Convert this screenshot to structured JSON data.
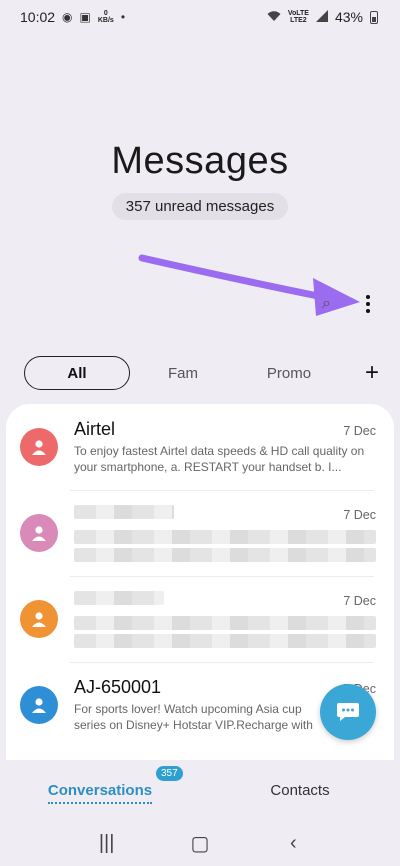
{
  "status_bar": {
    "time": "10:02",
    "speed_value": "0",
    "speed_unit": "KB/s",
    "network_top": "VoLTE",
    "network_bottom": "LTE2",
    "battery": "43%"
  },
  "header": {
    "title": "Messages",
    "unread": "357 unread messages"
  },
  "tabs": [
    {
      "label": "All",
      "active": true
    },
    {
      "label": "Fam",
      "active": false
    },
    {
      "label": "Promo",
      "active": false
    }
  ],
  "conversations": [
    {
      "sender": "Airtel",
      "date": "7 Dec",
      "preview": "To enjoy fastest Airtel data speeds & HD call quality on your smartphone, a. RESTART your handset b. I...",
      "avatar_color": "#ee6a6a"
    },
    {
      "sender": "",
      "date": "7 Dec",
      "preview": "",
      "avatar_color": "#d98ab8"
    },
    {
      "sender": "",
      "date": "7 Dec",
      "preview": "",
      "avatar_color": "#ef9335"
    },
    {
      "sender": "AJ-650001",
      "date": "7 Dec",
      "preview": "For sports lover! Watch upcoming Asia cup series on Disney+ Hotstar VIP.Recharge with",
      "avatar_color": "#2f8fd6"
    }
  ],
  "bottom_nav": {
    "conversations_label": "Conversations",
    "conversations_count": "357",
    "contacts_label": "Contacts"
  },
  "colors": {
    "accent": "#2d8fbf",
    "fab": "#3aa7d6",
    "arrow": "#9b6bf0"
  }
}
